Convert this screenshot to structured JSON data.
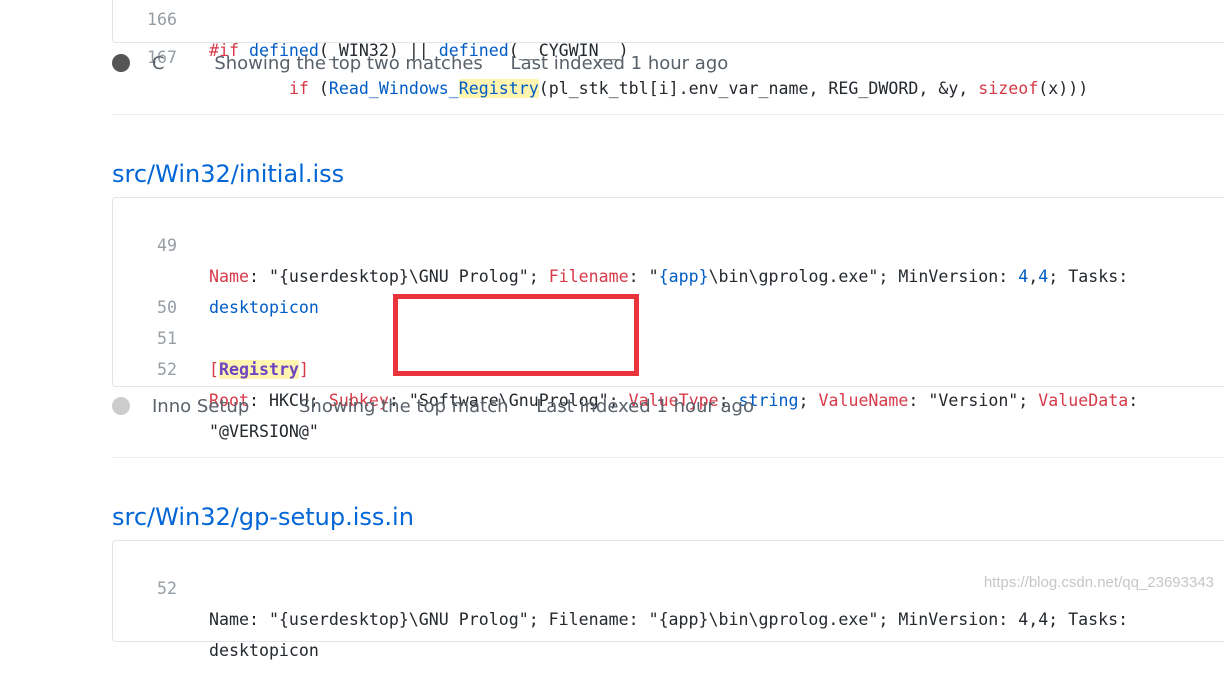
{
  "result1": {
    "lines": [
      {
        "num": "166",
        "text": "#if defined(_WIN32) || defined(__CYGWIN__)"
      },
      {
        "num": "167",
        "text": "if (Read_Windows_Registry(pl_stk_tbl[i].env_var_name, REG_DWORD, &y, sizeof(x)))"
      }
    ],
    "language": "C",
    "match_info": "Showing the top two matches",
    "indexed": "Last indexed 1 hour ago",
    "language_color": "#555555"
  },
  "result2": {
    "path": "src/Win32/initial.iss",
    "lines": [
      {
        "num": "49",
        "text": "Name: \"{userdesktop}\\GNU Prolog\"; Filename: \"{app}\\bin\\gprolog.exe\"; MinVersion: 4,4; Tasks:"
      },
      {
        "num": "",
        "text": "desktopicon"
      },
      {
        "num": "50",
        "text": ""
      },
      {
        "num": "51",
        "text": "[Registry]"
      },
      {
        "num": "52",
        "text": "Root: HKCU; Subkey: \"Software\\GnuProlog\"; ValueType: string; ValueName: \"Version\"; ValueData:"
      },
      {
        "num": "",
        "text": "\"@VERSION@\""
      }
    ],
    "language": "Inno Setup",
    "match_info": "Showing the top match",
    "indexed": "Last indexed 1 hour ago",
    "language_color": "#cccccc"
  },
  "result3": {
    "path": "src/Win32/gp-setup.iss.in",
    "lines": [
      {
        "num": "52",
        "text": "Name: \"{userdesktop}\\GNU Prolog\"; Filename: \"{app}\\bin\\gprolog.exe\"; MinVersion: 4,4; Tasks:"
      },
      {
        "num": "",
        "text": "desktopicon"
      }
    ]
  },
  "watermark": "https://blog.csdn.net/qq_23693343",
  "colors": {
    "highlight_box": "#e8343a",
    "link": "#0366d6"
  }
}
